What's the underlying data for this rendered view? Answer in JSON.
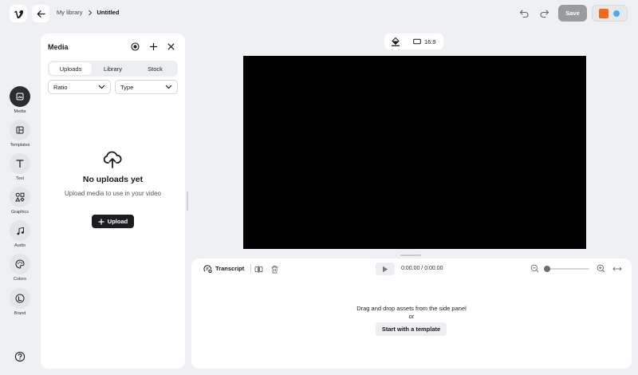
{
  "header": {
    "breadcrumb_parent": "My library",
    "breadcrumb_current": "Untitled",
    "save_label": "Save"
  },
  "rail": {
    "items": [
      {
        "label": "Media",
        "icon": "media-icon",
        "active": true
      },
      {
        "label": "Templates",
        "icon": "templates-icon"
      },
      {
        "label": "Text",
        "icon": "text-icon"
      },
      {
        "label": "Graphics",
        "icon": "graphics-icon"
      },
      {
        "label": "Audio",
        "icon": "audio-icon"
      },
      {
        "label": "Colors",
        "icon": "palette-icon"
      },
      {
        "label": "Brand",
        "icon": "brand-icon"
      }
    ]
  },
  "media_panel": {
    "title": "Media",
    "tabs": [
      "Uploads",
      "Library",
      "Stock"
    ],
    "active_tab": "Uploads",
    "filters": {
      "ratio": "Ratio",
      "type": "Type"
    },
    "empty_title": "No uploads yet",
    "empty_subtitle": "Upload media to use in your video",
    "upload_label": "Upload"
  },
  "canvas": {
    "aspect_ratio": "16:9",
    "background": "#000000"
  },
  "timeline": {
    "transcript_label": "Transcript",
    "time_display": "0:00.00 / 0:00.00",
    "drop_text": "Drag and drop assets from the side panel",
    "or_text": "or",
    "template_button": "Start with a template"
  },
  "colors": {
    "accent_dark": "#1c1d20",
    "save_disabled": "#9a9b9d"
  }
}
